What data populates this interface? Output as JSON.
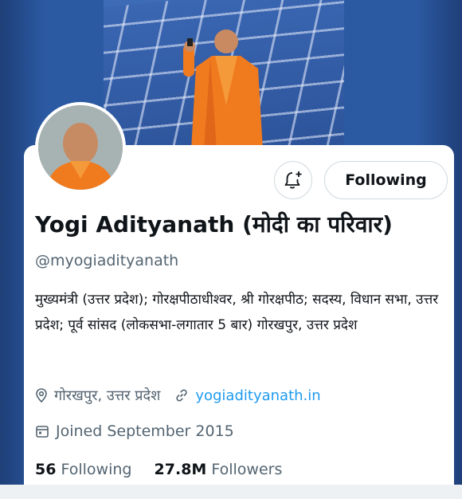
{
  "header": {
    "notify_icon": "bell-plus-icon",
    "following_label": "Following"
  },
  "profile": {
    "name": "Yogi Adityanath (मोदी का परिवार)",
    "handle": "@myogiadityanath",
    "bio": "मुख्यमंत्री (उत्तर प्रदेश); गोरक्षपीठाधीश्वर, श्री गोरक्षपीठ; सदस्य, विधान सभा, उत्तर प्रदेश; पूर्व सांसद (लोकसभा-लगातार 5 बार) गोरखपुर, उत्तर प्रदेश",
    "location": "गोरखपुर, उत्तर प्रदेश",
    "website": "yogiadityanath.in",
    "joined": "Joined September 2015"
  },
  "stats": {
    "following_count": "56",
    "following_label": "Following",
    "followers_count": "27.8M",
    "followers_label": "Followers"
  },
  "colors": {
    "accent": "#1d9bf0",
    "text_primary": "#0f1419",
    "text_secondary": "#536471",
    "robe": "#f07a1e"
  }
}
